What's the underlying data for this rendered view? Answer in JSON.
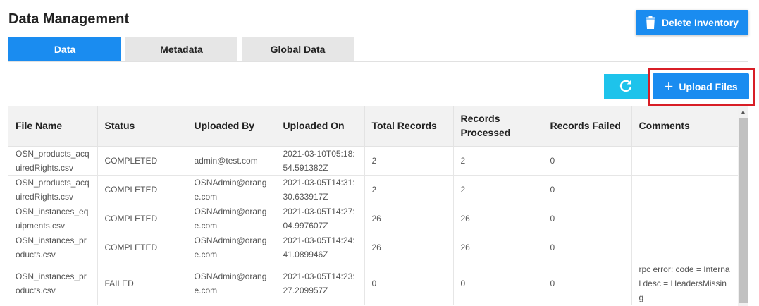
{
  "header": {
    "title": "Data Management",
    "delete_button": {
      "label": "Delete Inventory",
      "icon": "trash-icon"
    }
  },
  "tabs": [
    {
      "label": "Data",
      "active": true
    },
    {
      "label": "Metadata",
      "active": false
    },
    {
      "label": "Global Data",
      "active": false
    }
  ],
  "toolbar": {
    "refresh_icon": "refresh-icon",
    "upload_label": "Upload Files",
    "upload_icon": "plus-icon"
  },
  "colors": {
    "primary": "#1a8cf0",
    "refresh": "#1ec3eb",
    "highlight": "#d81e26",
    "header_bg": "#f2f2f2"
  },
  "table": {
    "columns": [
      "File Name",
      "Status",
      "Uploaded By",
      "Uploaded On",
      "Total Records",
      "Records Processed",
      "Records Failed",
      "Comments"
    ],
    "rows": [
      [
        "OSN_products_acquiredRights.csv",
        "COMPLETED",
        "admin@test.com",
        "2021-03-10T05:18:54.591382Z",
        "2",
        "2",
        "0",
        ""
      ],
      [
        "OSN_products_acquiredRights.csv",
        "COMPLETED",
        "OSNAdmin@orange.com",
        "2021-03-05T14:31:30.633917Z",
        "2",
        "2",
        "0",
        ""
      ],
      [
        "OSN_instances_equipments.csv",
        "COMPLETED",
        "OSNAdmin@orange.com",
        "2021-03-05T14:27:04.997607Z",
        "26",
        "26",
        "0",
        ""
      ],
      [
        "OSN_instances_products.csv",
        "COMPLETED",
        "OSNAdmin@orange.com",
        "2021-03-05T14:24:41.089946Z",
        "26",
        "26",
        "0",
        ""
      ],
      [
        "OSN_instances_products.csv",
        "FAILED",
        "OSNAdmin@orange.com",
        "2021-03-05T14:23:27.209957Z",
        "0",
        "0",
        "0",
        "rpc error: code = Internal desc = HeadersMissing"
      ]
    ]
  }
}
